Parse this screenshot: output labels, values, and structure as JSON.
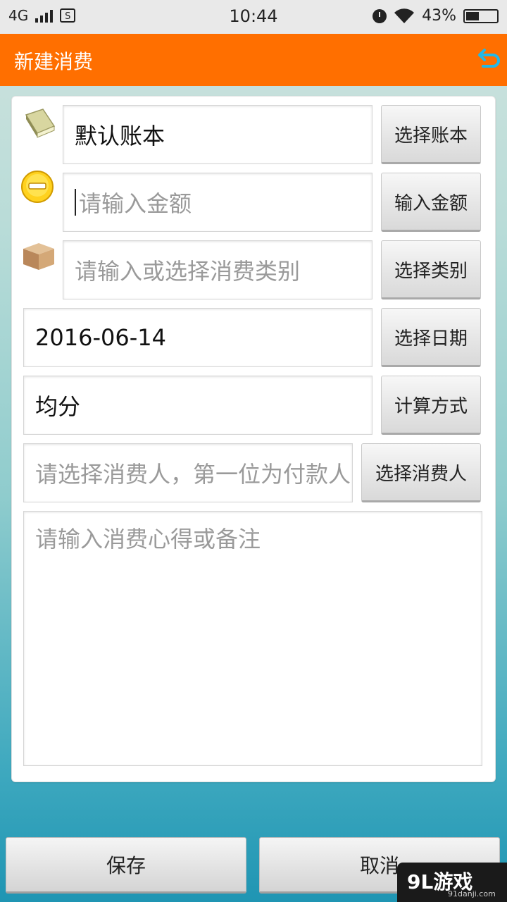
{
  "status_bar": {
    "network": "4G",
    "sim": "S",
    "time": "10:44",
    "battery": "43%",
    "battery_level": 0.43
  },
  "header": {
    "title": "新建消费",
    "back_icon": "back-arrow-icon",
    "accent": "#ff6f00"
  },
  "form": {
    "book": {
      "value": "默认账本",
      "button": "选择账本",
      "icon": "book-icon"
    },
    "amount": {
      "placeholder": "请输入金额",
      "button": "输入金额",
      "icon": "minus-coin-icon"
    },
    "category": {
      "placeholder": "请输入或选择消费类别",
      "button": "选择类别",
      "icon": "box-icon"
    },
    "date": {
      "value": "2016-06-14",
      "button": "选择日期"
    },
    "method": {
      "value": "均分",
      "button": "计算方式"
    },
    "consumers": {
      "placeholder": "请选择消费人，第一位为付款人",
      "button": "选择消费人"
    },
    "note": {
      "placeholder": "请输入消费心得或备注"
    }
  },
  "actions": {
    "save": "保存",
    "cancel": "取消"
  },
  "watermark": {
    "main": "9L游戏",
    "sub": "91danji.com"
  }
}
